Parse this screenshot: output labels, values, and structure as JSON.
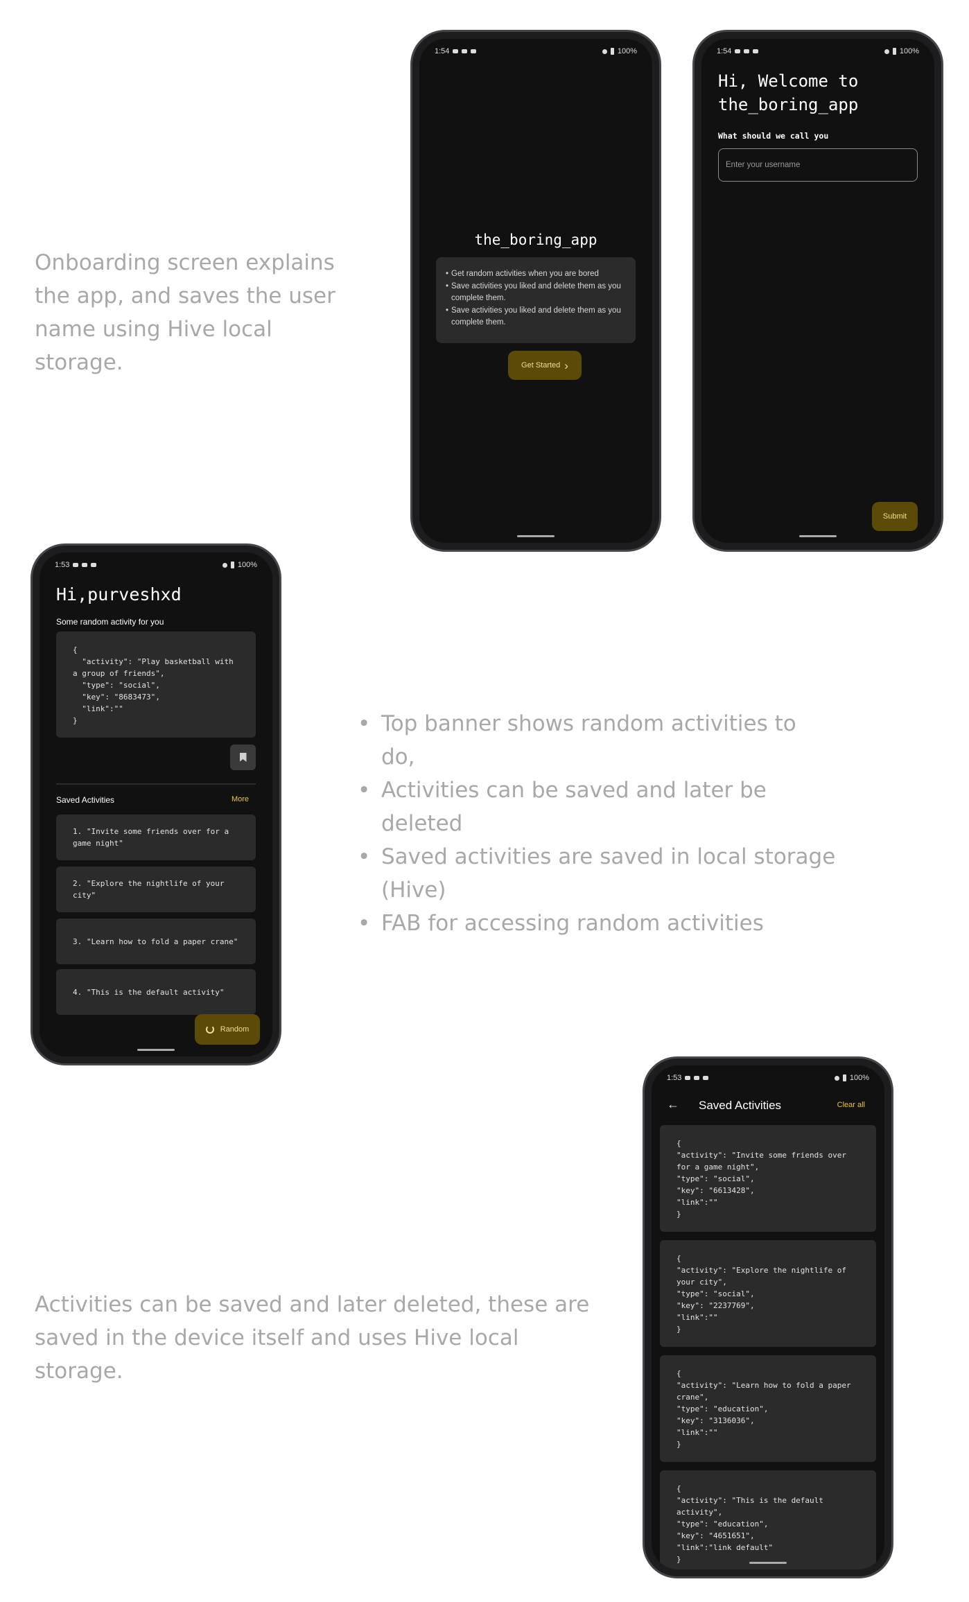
{
  "captions": {
    "onboarding": "Onboarding screen explains the app, and saves the user name using Hive local storage.",
    "home_bullets": [
      "Top banner shows random activities to do,",
      "Activities can be saved and later be deleted",
      "Saved activities are saved in local storage (Hive)",
      "FAB for accessing random activities"
    ],
    "saved": "Activities can be saved and later deleted, these are saved in the device itself and uses Hive local storage."
  },
  "onboarding_screen": {
    "status_time": "1:54",
    "status_battery": "100%",
    "app_title": "the_boring_app",
    "features": [
      "Get random activities when you are bored",
      "Save activities you liked and delete them as you complete them.",
      "Save activities you liked and delete them as you complete them."
    ],
    "get_started_label": "Get Started"
  },
  "welcome_screen": {
    "status_time": "1:54",
    "status_battery": "100%",
    "title": "Hi, Welcome to the_boring_app",
    "prompt": "What should we call you",
    "username_placeholder": "Enter your username",
    "submit_label": "Submit"
  },
  "home_screen": {
    "status_time": "1:53",
    "status_battery": "100%",
    "greeting": "Hi,purveshxd",
    "subtitle": "Some random activity for you",
    "random_activity_json": "{\n  \"activity\": \"Play basketball with a group of friends\",\n  \"type\": \"social\",\n  \"key\": \"8683473\",\n  \"link\":\"\"\n}",
    "saved_heading": "Saved Activities",
    "more_label": "More",
    "saved_items": [
      "1. \"Invite some friends over for a game night\"",
      "2. \"Explore the nightlife of your city\"",
      "3. \"Learn how to fold a paper crane\"",
      "4. \"This is the default activity\""
    ],
    "fab_label": "Random"
  },
  "saved_screen": {
    "status_time": "1:53",
    "status_battery": "100%",
    "title": "Saved Activities",
    "clear_all_label": "Clear all",
    "cards": [
      "{\n\"activity\": \"Invite some friends over for a game night\",\n\"type\": \"social\",\n\"key\": \"6613428\",\n\"link\":\"\"\n}",
      "{\n\"activity\": \"Explore the nightlife of your city\",\n\"type\": \"social\",\n\"key\": \"2237769\",\n\"link\":\"\"\n}",
      "{\n\"activity\": \"Learn how to fold a paper crane\",\n\"type\": \"education\",\n\"key\": \"3136036\",\n\"link\":\"\"\n}",
      "{\n\"activity\": \"This is the default activity\",\n\"type\": \"education\",\n\"key\": \"4651651\",\n\"link\":\"link default\"\n}"
    ]
  },
  "colors": {
    "accent": "#e9c43f",
    "button_bg": "#5b4a08",
    "screen_bg": "#111111",
    "card_bg": "#2b2b2b",
    "caption_text": "#a8a8a8"
  }
}
